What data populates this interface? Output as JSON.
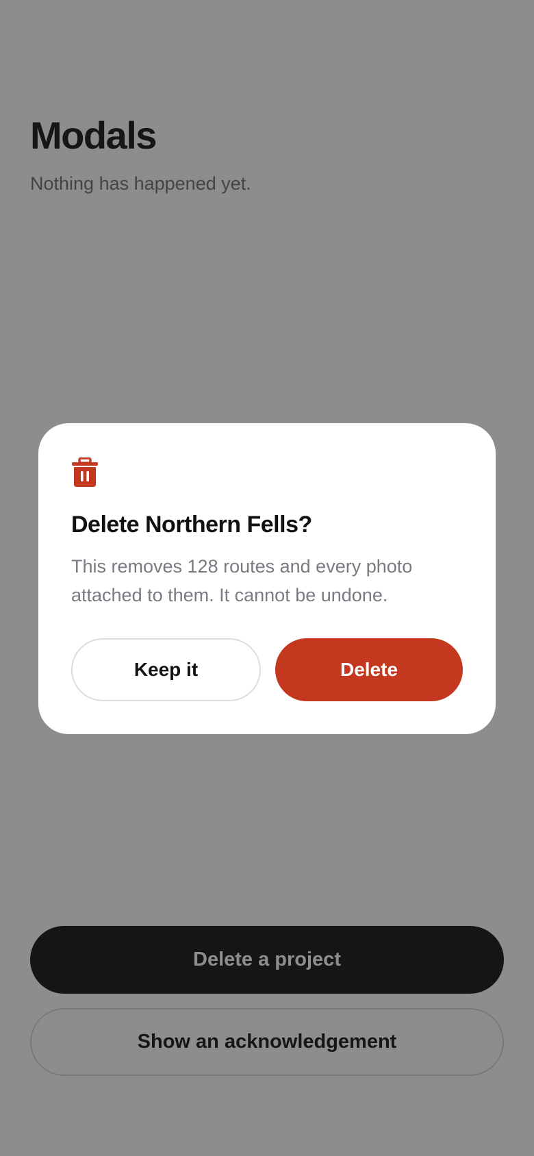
{
  "page": {
    "title": "Modals",
    "status": "Nothing has happened yet."
  },
  "actions": {
    "primary_label": "Delete a project",
    "secondary_label": "Show an acknowledgement"
  },
  "dialog": {
    "icon": "trash-icon",
    "title": "Delete Northern Fells?",
    "body": "This removes 128 routes and every photo attached to them. It cannot be undone.",
    "cancel_label": "Keep it",
    "confirm_label": "Delete"
  },
  "colors": {
    "destructive": "#c43820",
    "primary_button": "#0f0f13",
    "scrim": "rgba(28,28,28,0.5)"
  }
}
